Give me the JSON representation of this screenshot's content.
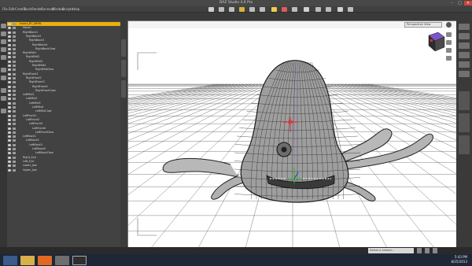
{
  "app": {
    "title": "DAZ Studio 4.6 Pro",
    "menus": [
      "File",
      "Edit",
      "Create",
      "Tools",
      "Render",
      "Connect",
      "Window",
      "Scripts",
      "Help"
    ]
  },
  "scene_tree": [
    {
      "label": "Insect_B7_WHW",
      "depth": 0,
      "selected": true
    },
    {
      "label": "Mouth",
      "depth": 1
    },
    {
      "label": "RightBack1",
      "depth": 1
    },
    {
      "label": "RightBack2",
      "depth": 2
    },
    {
      "label": "RightBack3",
      "depth": 3
    },
    {
      "label": "RightBack4",
      "depth": 4
    },
    {
      "label": "RightBackClaw",
      "depth": 5
    },
    {
      "label": "RightMid1",
      "depth": 1
    },
    {
      "label": "RightMid2",
      "depth": 2
    },
    {
      "label": "RightMid3",
      "depth": 3
    },
    {
      "label": "RightMid4",
      "depth": 4
    },
    {
      "label": "RightMidClaw",
      "depth": 5
    },
    {
      "label": "RightFront1",
      "depth": 1
    },
    {
      "label": "RightFront2",
      "depth": 2
    },
    {
      "label": "RightFront3",
      "depth": 3
    },
    {
      "label": "RightFront4",
      "depth": 4
    },
    {
      "label": "RightFrontClaw",
      "depth": 5
    },
    {
      "label": "LeftMid1",
      "depth": 1
    },
    {
      "label": "LeftMid2",
      "depth": 2
    },
    {
      "label": "LeftMid3",
      "depth": 3
    },
    {
      "label": "LeftMid4",
      "depth": 4
    },
    {
      "label": "LeftMidClaw",
      "depth": 5
    },
    {
      "label": "LeftFront1",
      "depth": 1
    },
    {
      "label": "LeftFront2",
      "depth": 2
    },
    {
      "label": "LeftFront3",
      "depth": 3
    },
    {
      "label": "LeftFront4",
      "depth": 4
    },
    {
      "label": "LeftFrontClaw",
      "depth": 5
    },
    {
      "label": "LeftBack1",
      "depth": 1
    },
    {
      "label": "LeftBack2",
      "depth": 2
    },
    {
      "label": "LeftBack3",
      "depth": 3
    },
    {
      "label": "LeftBack4",
      "depth": 4
    },
    {
      "label": "LeftBackClaw",
      "depth": 5
    },
    {
      "label": "Right_Eye",
      "depth": 1
    },
    {
      "label": "Left_Eye",
      "depth": 1
    },
    {
      "label": "Lower_Jaw",
      "depth": 1
    },
    {
      "label": "Upper_Jaw",
      "depth": 1
    }
  ],
  "viewport": {
    "camera": "Perspective View"
  },
  "status": {
    "lesson_placeholder": "Select a Lesson..."
  },
  "taskbar": {
    "time": "5:43 PM",
    "date": "8/25/2013"
  },
  "colors": {
    "accent": "#e8b00f",
    "taskbar": "#1d2738"
  }
}
